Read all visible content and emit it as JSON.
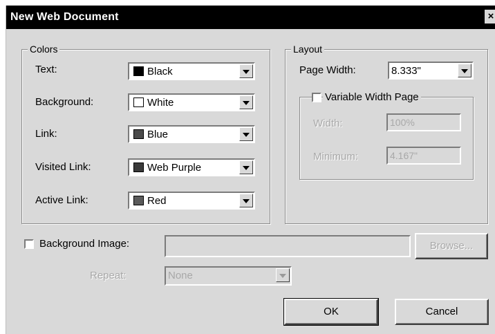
{
  "window": {
    "title": "New Web Document",
    "close_glyph": "×"
  },
  "colors_group": {
    "legend": "Colors",
    "rows": [
      {
        "label": "Text:",
        "value": "Black",
        "swatch": "#000000"
      },
      {
        "label": "Background:",
        "value": "White",
        "swatch": "#ffffff"
      },
      {
        "label": "Link:",
        "value": "Blue",
        "swatch": "#4a4a4a"
      },
      {
        "label": "Visited Link:",
        "value": "Web Purple",
        "swatch": "#3a3a3a"
      },
      {
        "label": "Active Link:",
        "value": "Red",
        "swatch": "#5a5a5a"
      }
    ]
  },
  "layout_group": {
    "legend": "Layout",
    "page_width_label": "Page Width:",
    "page_width_value": "8.333\"",
    "variable_width": {
      "label": "Variable Width Page",
      "checked": false,
      "width_label": "Width:",
      "width_value": "100%",
      "minimum_label": "Minimum:",
      "minimum_value": "4.167\""
    }
  },
  "background_image": {
    "label": "Background Image:",
    "checked": false,
    "path_value": "",
    "browse_label": "Browse...",
    "repeat_label": "Repeat:",
    "repeat_value": "None"
  },
  "buttons": {
    "ok": "OK",
    "cancel": "Cancel"
  }
}
